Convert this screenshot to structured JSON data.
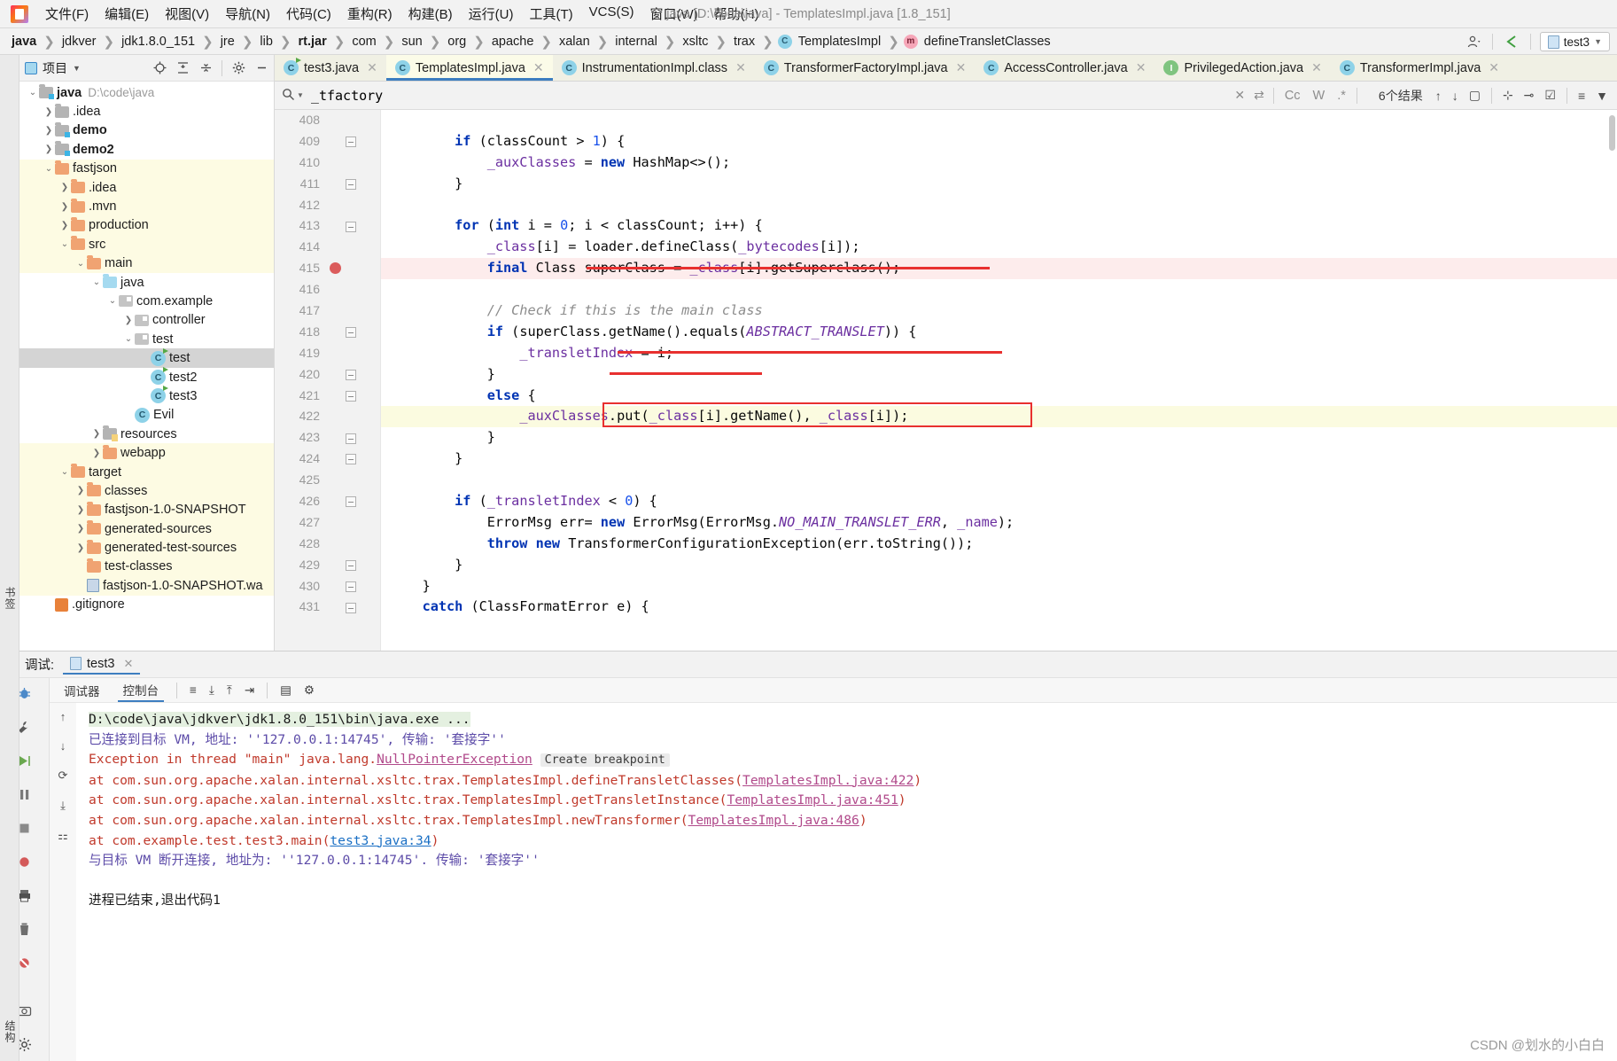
{
  "menubar": {
    "items": [
      "文件(F)",
      "编辑(E)",
      "视图(V)",
      "导航(N)",
      "代码(C)",
      "重构(R)",
      "构建(B)",
      "运行(U)",
      "工具(T)",
      "VCS(S)",
      "窗口(W)",
      "帮助(H)"
    ],
    "window_title": "java [D:\\code\\java] - TemplatesImpl.java [1.8_151]"
  },
  "navbar": {
    "crumbs": [
      {
        "label": "java",
        "bold": true,
        "icon": ""
      },
      {
        "label": "jdkver",
        "bold": false,
        "icon": ""
      },
      {
        "label": "jdk1.8.0_151",
        "bold": false,
        "icon": ""
      },
      {
        "label": "jre",
        "bold": false,
        "icon": ""
      },
      {
        "label": "lib",
        "bold": false,
        "icon": ""
      },
      {
        "label": "rt.jar",
        "bold": true,
        "icon": ""
      },
      {
        "label": "com",
        "bold": false,
        "icon": ""
      },
      {
        "label": "sun",
        "bold": false,
        "icon": ""
      },
      {
        "label": "org",
        "bold": false,
        "icon": ""
      },
      {
        "label": "apache",
        "bold": false,
        "icon": ""
      },
      {
        "label": "xalan",
        "bold": false,
        "icon": ""
      },
      {
        "label": "internal",
        "bold": false,
        "icon": ""
      },
      {
        "label": "xsltc",
        "bold": false,
        "icon": ""
      },
      {
        "label": "trax",
        "bold": false,
        "icon": ""
      },
      {
        "label": "TemplatesImpl",
        "bold": false,
        "icon": "class-icon"
      },
      {
        "label": "defineTransletClasses",
        "bold": false,
        "icon": "method-icon"
      }
    ],
    "run_config": "test3"
  },
  "project": {
    "title": "项目",
    "tree": [
      {
        "label": "java",
        "sub": "D:\\code\\java",
        "depth": 0,
        "arrow": "down",
        "icon": "module-folder",
        "bold": true,
        "state": "normal"
      },
      {
        "label": ".idea",
        "sub": "",
        "depth": 1,
        "arrow": "right",
        "icon": "folder-gray",
        "bold": false,
        "state": "normal"
      },
      {
        "label": "demo",
        "sub": "",
        "depth": 1,
        "arrow": "right",
        "icon": "module-folder",
        "bold": true,
        "state": "normal"
      },
      {
        "label": "demo2",
        "sub": "",
        "depth": 1,
        "arrow": "right",
        "icon": "module-folder",
        "bold": true,
        "state": "normal"
      },
      {
        "label": "fastjson",
        "sub": "",
        "depth": 1,
        "arrow": "down",
        "icon": "folder-orange",
        "bold": false,
        "state": "yellow"
      },
      {
        "label": ".idea",
        "sub": "",
        "depth": 2,
        "arrow": "right",
        "icon": "folder-orange",
        "bold": false,
        "state": "yellow"
      },
      {
        "label": ".mvn",
        "sub": "",
        "depth": 2,
        "arrow": "right",
        "icon": "folder-orange",
        "bold": false,
        "state": "yellow"
      },
      {
        "label": "production",
        "sub": "",
        "depth": 2,
        "arrow": "right",
        "icon": "folder-orange",
        "bold": false,
        "state": "yellow"
      },
      {
        "label": "src",
        "sub": "",
        "depth": 2,
        "arrow": "down",
        "icon": "folder-orange",
        "bold": false,
        "state": "yellow"
      },
      {
        "label": "main",
        "sub": "",
        "depth": 3,
        "arrow": "down",
        "icon": "folder-orange",
        "bold": false,
        "state": "yellow"
      },
      {
        "label": "java",
        "sub": "",
        "depth": 4,
        "arrow": "down",
        "icon": "folder-blue",
        "bold": false,
        "state": "normal"
      },
      {
        "label": "com.example",
        "sub": "",
        "depth": 5,
        "arrow": "down",
        "icon": "package",
        "bold": false,
        "state": "normal"
      },
      {
        "label": "controller",
        "sub": "",
        "depth": 6,
        "arrow": "right",
        "icon": "package",
        "bold": false,
        "state": "normal"
      },
      {
        "label": "test",
        "sub": "",
        "depth": 6,
        "arrow": "down",
        "icon": "package",
        "bold": false,
        "state": "normal"
      },
      {
        "label": "test",
        "sub": "",
        "depth": 7,
        "arrow": "none",
        "icon": "class-runnable",
        "bold": false,
        "state": "selected"
      },
      {
        "label": "test2",
        "sub": "",
        "depth": 7,
        "arrow": "none",
        "icon": "class-runnable",
        "bold": false,
        "state": "normal"
      },
      {
        "label": "test3",
        "sub": "",
        "depth": 7,
        "arrow": "none",
        "icon": "class-runnable",
        "bold": false,
        "state": "normal"
      },
      {
        "label": "Evil",
        "sub": "",
        "depth": 6,
        "arrow": "none",
        "icon": "class",
        "bold": false,
        "state": "normal"
      },
      {
        "label": "resources",
        "sub": "",
        "depth": 4,
        "arrow": "right",
        "icon": "folder-resources",
        "bold": false,
        "state": "normal"
      },
      {
        "label": "webapp",
        "sub": "",
        "depth": 4,
        "arrow": "right",
        "icon": "folder-orange",
        "bold": false,
        "state": "yellow"
      },
      {
        "label": "target",
        "sub": "",
        "depth": 2,
        "arrow": "down",
        "icon": "folder-orange",
        "bold": false,
        "state": "yellow"
      },
      {
        "label": "classes",
        "sub": "",
        "depth": 3,
        "arrow": "right",
        "icon": "folder-orange",
        "bold": false,
        "state": "yellow"
      },
      {
        "label": "fastjson-1.0-SNAPSHOT",
        "sub": "",
        "depth": 3,
        "arrow": "right",
        "icon": "folder-orange",
        "bold": false,
        "state": "yellow"
      },
      {
        "label": "generated-sources",
        "sub": "",
        "depth": 3,
        "arrow": "right",
        "icon": "folder-orange",
        "bold": false,
        "state": "yellow"
      },
      {
        "label": "generated-test-sources",
        "sub": "",
        "depth": 3,
        "arrow": "right",
        "icon": "folder-orange",
        "bold": false,
        "state": "yellow"
      },
      {
        "label": "test-classes",
        "sub": "",
        "depth": 3,
        "arrow": "none",
        "icon": "folder-orange",
        "bold": false,
        "state": "yellow"
      },
      {
        "label": "fastjson-1.0-SNAPSHOT.wa",
        "sub": "",
        "depth": 3,
        "arrow": "none",
        "icon": "war",
        "bold": false,
        "state": "yellow"
      },
      {
        "label": ".gitignore",
        "sub": "",
        "depth": 1,
        "arrow": "none",
        "icon": "git",
        "bold": false,
        "state": "normal"
      }
    ]
  },
  "editor": {
    "tabs": [
      {
        "label": "test3.java",
        "icon": "class-runnable-icon",
        "active": false
      },
      {
        "label": "TemplatesImpl.java",
        "icon": "class-icon",
        "active": true
      },
      {
        "label": "InstrumentationImpl.class",
        "icon": "class-icon",
        "active": false
      },
      {
        "label": "TransformerFactoryImpl.java",
        "icon": "class-icon",
        "active": false
      },
      {
        "label": "AccessController.java",
        "icon": "class-icon",
        "active": false
      },
      {
        "label": "PrivilegedAction.java",
        "icon": "interface-icon",
        "active": false
      },
      {
        "label": "TransformerImpl.java",
        "icon": "class-icon",
        "active": false
      }
    ],
    "find": {
      "value": "_tfactory",
      "options": [
        "Cc",
        "W",
        ".*"
      ],
      "result_count": "6个结果"
    },
    "first_line_number": 408,
    "lines": [
      {
        "n": 408,
        "text": "",
        "fold": "",
        "bp": false,
        "hl": ""
      },
      {
        "n": 409,
        "text": "        if (classCount > 1) {",
        "fold": "open",
        "bp": false,
        "hl": ""
      },
      {
        "n": 410,
        "text": "            _auxClasses = new HashMap<>();",
        "fold": "",
        "bp": false,
        "hl": ""
      },
      {
        "n": 411,
        "text": "        }",
        "fold": "close",
        "bp": false,
        "hl": ""
      },
      {
        "n": 412,
        "text": "",
        "fold": "",
        "bp": false,
        "hl": ""
      },
      {
        "n": 413,
        "text": "        for (int i = 0; i < classCount; i++) {",
        "fold": "open",
        "bp": false,
        "hl": ""
      },
      {
        "n": 414,
        "text": "            _class[i] = loader.defineClass(_bytecodes[i]);",
        "fold": "",
        "bp": false,
        "hl": ""
      },
      {
        "n": 415,
        "text": "            final Class superClass = _class[i].getSuperclass();",
        "fold": "",
        "bp": true,
        "hl": "red"
      },
      {
        "n": 416,
        "text": "",
        "fold": "",
        "bp": false,
        "hl": ""
      },
      {
        "n": 417,
        "text": "            // Check if this is the main class",
        "fold": "",
        "bp": false,
        "hl": ""
      },
      {
        "n": 418,
        "text": "            if (superClass.getName().equals(ABSTRACT_TRANSLET)) {",
        "fold": "open",
        "bp": false,
        "hl": ""
      },
      {
        "n": 419,
        "text": "                _transletIndex = i;",
        "fold": "",
        "bp": false,
        "hl": ""
      },
      {
        "n": 420,
        "text": "            }",
        "fold": "close",
        "bp": false,
        "hl": ""
      },
      {
        "n": 421,
        "text": "            else {",
        "fold": "open",
        "bp": false,
        "hl": ""
      },
      {
        "n": 422,
        "text": "                _auxClasses.put(_class[i].getName(), _class[i]);",
        "fold": "",
        "bp": false,
        "hl": "yellow"
      },
      {
        "n": 423,
        "text": "            }",
        "fold": "close",
        "bp": false,
        "hl": ""
      },
      {
        "n": 424,
        "text": "        }",
        "fold": "close",
        "bp": false,
        "hl": ""
      },
      {
        "n": 425,
        "text": "",
        "fold": "",
        "bp": false,
        "hl": ""
      },
      {
        "n": 426,
        "text": "        if (_transletIndex < 0) {",
        "fold": "open",
        "bp": false,
        "hl": ""
      },
      {
        "n": 427,
        "text": "            ErrorMsg err= new ErrorMsg(ErrorMsg.NO_MAIN_TRANSLET_ERR, _name);",
        "fold": "",
        "bp": false,
        "hl": ""
      },
      {
        "n": 428,
        "text": "            throw new TransformerConfigurationException(err.toString());",
        "fold": "",
        "bp": false,
        "hl": ""
      },
      {
        "n": 429,
        "text": "        }",
        "fold": "close",
        "bp": false,
        "hl": ""
      },
      {
        "n": 430,
        "text": "    }",
        "fold": "close",
        "bp": false,
        "hl": ""
      },
      {
        "n": 431,
        "text": "    catch (ClassFormatError e) {",
        "fold": "open",
        "bp": false,
        "hl": ""
      }
    ]
  },
  "debug": {
    "title": "调试:",
    "tab_label": "test3",
    "toolbar_tabs": [
      "调试器",
      "控制台"
    ],
    "console": [
      {
        "type": "cmd",
        "text": "D:\\code\\java\\jdkver\\jdk1.8.0_151\\bin\\java.exe ..."
      },
      {
        "type": "info",
        "text": "已连接到目标 VM, 地址: ''127.0.0.1:14745', 传输: '套接字''"
      },
      {
        "type": "exception",
        "prefix": "Exception in thread \"main\" java.lang.",
        "link": "NullPointerException",
        "chip": "Create breakpoint"
      },
      {
        "type": "frame",
        "prefix": "    at com.sun.org.apache.xalan.internal.xsltc.trax.TemplatesImpl.defineTransletClasses(",
        "link": "TemplatesImpl.java:422",
        "suffix": ")"
      },
      {
        "type": "frame",
        "prefix": "    at com.sun.org.apache.xalan.internal.xsltc.trax.TemplatesImpl.getTransletInstance(",
        "link": "TemplatesImpl.java:451",
        "suffix": ")"
      },
      {
        "type": "frame",
        "prefix": "    at com.sun.org.apache.xalan.internal.xsltc.trax.TemplatesImpl.newTransformer(",
        "link": "TemplatesImpl.java:486",
        "suffix": ")"
      },
      {
        "type": "frame-blue",
        "prefix": "    at com.example.test.test3.main(",
        "link": "test3.java:34",
        "suffix": ")"
      },
      {
        "type": "info",
        "text": "与目标 VM 断开连接, 地址为: ''127.0.0.1:14745'. 传输: '套接字''"
      },
      {
        "type": "blank",
        "text": ""
      },
      {
        "type": "plain",
        "text": "进程已结束,退出代码1"
      }
    ]
  },
  "watermark": "CSDN @划水的小白白",
  "colors": {
    "accent": "#3d7ec0",
    "error": "#e8302f",
    "folder_orange": "#f0a372",
    "keyword": "#0033b3",
    "field": "#6b2fa0"
  }
}
